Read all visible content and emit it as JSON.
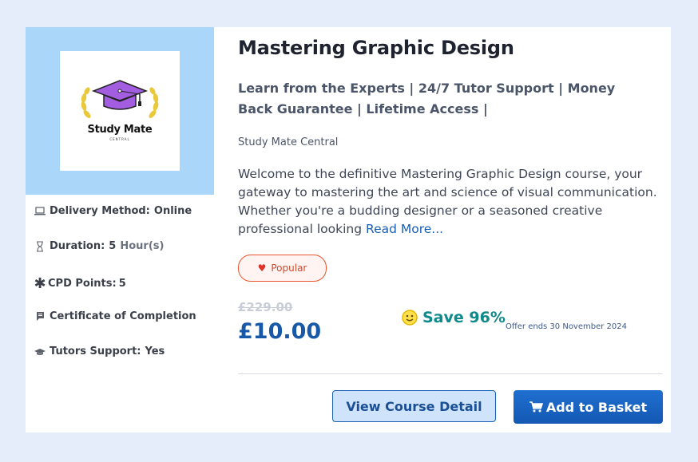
{
  "logo": {
    "name": "Study Mate",
    "sub": "CENTRAL"
  },
  "meta": {
    "delivery": {
      "label": "Delivery Method:",
      "value": "Online",
      "icon": "laptop-icon"
    },
    "duration": {
      "label": "Duration:",
      "value": "5",
      "unit": "Hour(s)",
      "icon": "hourglass-icon"
    },
    "cpd": {
      "label": "CPD Points:",
      "value": "5",
      "icon": "asterisk-icon"
    },
    "certificate": {
      "label": "Certificate of Completion",
      "icon": "certificate-icon"
    },
    "tutors": {
      "label": "Tutors Support:",
      "value": "Yes",
      "icon": "graduation-cap-icon"
    }
  },
  "course": {
    "title": "Mastering Graphic Design",
    "tagline": "Learn from the Experts | 24/7 Tutor Support | Money Back Guarantee | Lifetime Access |",
    "provider": "Study Mate Central",
    "description": "Welcome to the definitive Mastering Graphic Design course, your gateway to mastering the art and science of visual communication. Whether you're a budding designer or a seasoned creative professional looking",
    "read_more": "Read More..."
  },
  "badge": {
    "label": "Popular",
    "icon": "heart-icon"
  },
  "pricing": {
    "old_price": "£229.00",
    "price": "£10.00",
    "save": "Save 96%",
    "offer": "Offer ends 30 November 2024"
  },
  "actions": {
    "view_detail": "View Course Detail",
    "add_basket": "Add to Basket"
  },
  "colors": {
    "accent": "#1a5fb4",
    "save": "#0f8a8a",
    "badge": "#e8542e",
    "logo_panel": "#a9d6f9"
  }
}
